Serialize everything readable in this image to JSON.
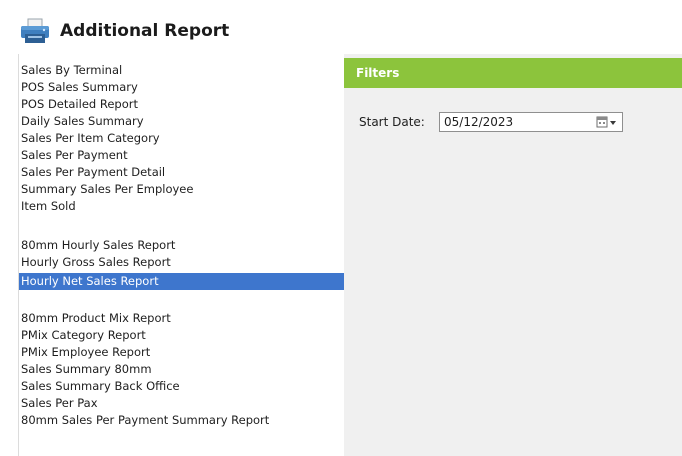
{
  "header": {
    "title": "Additional Report",
    "icon": "printer-icon"
  },
  "report_list": {
    "selected_index": 11,
    "items": [
      {
        "label": "Sales By Terminal"
      },
      {
        "label": "POS Sales Summary"
      },
      {
        "label": "POS Detailed Report"
      },
      {
        "label": "Daily Sales Summary"
      },
      {
        "label": "Sales Per Item Category"
      },
      {
        "label": "Sales Per Payment"
      },
      {
        "label": "Sales Per Payment Detail"
      },
      {
        "label": "Summary Sales Per Employee"
      },
      {
        "label": "Item Sold"
      },
      {
        "label": "80mm Hourly Sales Report"
      },
      {
        "label": "Hourly Gross Sales Report"
      },
      {
        "label": "Hourly Net Sales Report"
      },
      {
        "label": "80mm Product Mix Report"
      },
      {
        "label": "PMix Category Report"
      },
      {
        "label": "PMix Employee Report"
      },
      {
        "label": "Sales Summary 80mm"
      },
      {
        "label": "Sales Summary Back Office"
      },
      {
        "label": "Sales Per Pax"
      },
      {
        "label": "80mm Sales Per Payment Summary Report"
      }
    ]
  },
  "filters": {
    "title": "Filters",
    "start_date_label": "Start Date:",
    "start_date_value": "05/12/2023",
    "calendar_icon": "calendar-dropdown-icon"
  },
  "colors": {
    "filters_bar": "#8cc43c",
    "selection": "#3e76cd",
    "right_panel": "#f0f0f0"
  }
}
